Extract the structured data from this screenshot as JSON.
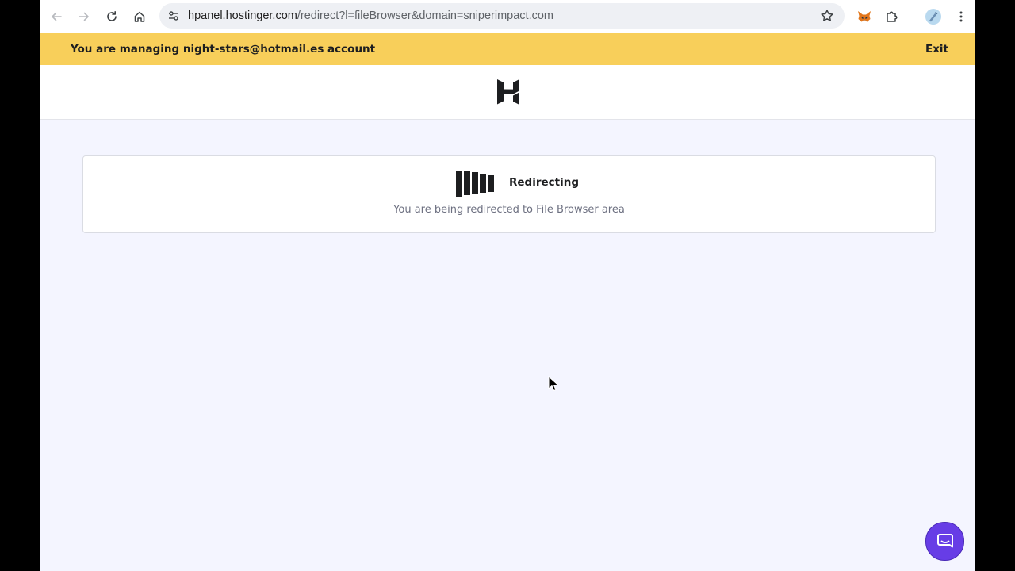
{
  "browser": {
    "url_host": "hpanel.hostinger.com",
    "url_path": "/redirect?l=fileBrowser&domain=sniperimpact.com",
    "icons": [
      "back-arrow-icon",
      "forward-arrow-icon",
      "reload-icon",
      "home-icon",
      "site-settings-icon",
      "bookmark-star-icon",
      "metamask-extension-icon",
      "extensions-puzzle-icon",
      "profile-avatar-icon",
      "browser-menu-icon"
    ]
  },
  "banner": {
    "text": "You are managing night-stars@hotmail.es account",
    "exit_label": "Exit",
    "color": "#f8cf5a"
  },
  "header": {
    "logo_icon": "hostinger-logo-icon"
  },
  "redirect": {
    "title": "Redirecting",
    "message": "You are being redirected to File Browser area",
    "loader_icon": "loading-bars-icon"
  },
  "chat": {
    "icon": "chat-bubble-icon",
    "color": "#673de6"
  }
}
